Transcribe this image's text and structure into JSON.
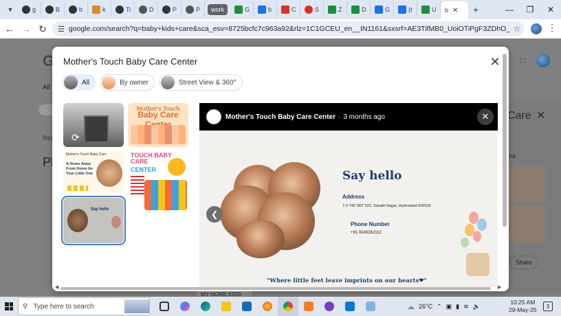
{
  "browser": {
    "tabs": [
      {
        "label": "g",
        "color": "#24292f"
      },
      {
        "label": "B",
        "color": "#24292f"
      },
      {
        "label": "b",
        "color": "#24292f"
      },
      {
        "label": "k",
        "color": "#d98c2b"
      },
      {
        "label": "Ti",
        "color": "#222222"
      },
      {
        "label": "D",
        "color": "#555555"
      },
      {
        "label": "P",
        "color": "#222222"
      },
      {
        "label": "P",
        "color": "#555555"
      }
    ],
    "tab_group_label": "work",
    "group_tabs": [
      {
        "label": "G",
        "color": "#1e8e3e"
      },
      {
        "label": "b",
        "color": "#1a73e8"
      },
      {
        "label": "C",
        "color": "#d93025"
      },
      {
        "label": "S",
        "color": "#d93025"
      },
      {
        "label": "Z",
        "color": "#1e8e3e"
      },
      {
        "label": "D",
        "color": "#1e8e3e"
      },
      {
        "label": "G",
        "color": "#1a73e8"
      },
      {
        "label": "(t",
        "color": "#1a73e8"
      },
      {
        "label": "U",
        "color": "#1e8e3e"
      }
    ],
    "active_tab_label": "b",
    "url": "google.com/search?q=baby+kids+care&sca_esv=8725bcfc7c963a92&rlz=1C1GCEU_en__IN1161&sxsrf=AE3TifMB0_UoiOTiPgF3ZDhO_eih2q-wvA%3A1748493..."
  },
  "background_page": {
    "logo_letter": "G",
    "all_tab": "All",
    "results_text": "Res",
    "heading_fragment": "Pl",
    "side_panel_title": "Care",
    "side_panel_sub": "na",
    "share_label": "Share",
    "my_home_kids": "MY HOME KIDS"
  },
  "modal": {
    "title": "Mother's Touch Baby Care Center",
    "filters": [
      {
        "label": "All",
        "selected": true
      },
      {
        "label": "By owner",
        "selected": false
      },
      {
        "label": "Street View & 360°",
        "selected": false
      }
    ],
    "thumbnails": {
      "t2_top": "Mother's Touch",
      "t2_big": "Baby Care Center",
      "t3_top": "Mother's Touch Baby Care",
      "t3_text": "A Home Away From Home for Your Little One",
      "t4_title": "TOUCH BABY CARE",
      "t4_center": "CENTER",
      "t5_text": "Say hello"
    },
    "preview": {
      "poster_name": "Mother's Touch Baby Care Center",
      "separator": "·",
      "posted_ago": "3 months ago",
      "heading": "Say hello",
      "address_label": "Address",
      "address_value": "7-2-742 SRT 522, Sanath Nagar, Hyderabad 500018",
      "phone_label": "Phone Number",
      "phone_value": "+91 9246262112",
      "tagline": "\"Where little feet leave imprints on our hearts❤\""
    }
  },
  "taskbar": {
    "search_placeholder": "Type here to search",
    "weather": "26°C",
    "time": "10:25 AM",
    "date": "29-May-25",
    "notifications": "3"
  }
}
